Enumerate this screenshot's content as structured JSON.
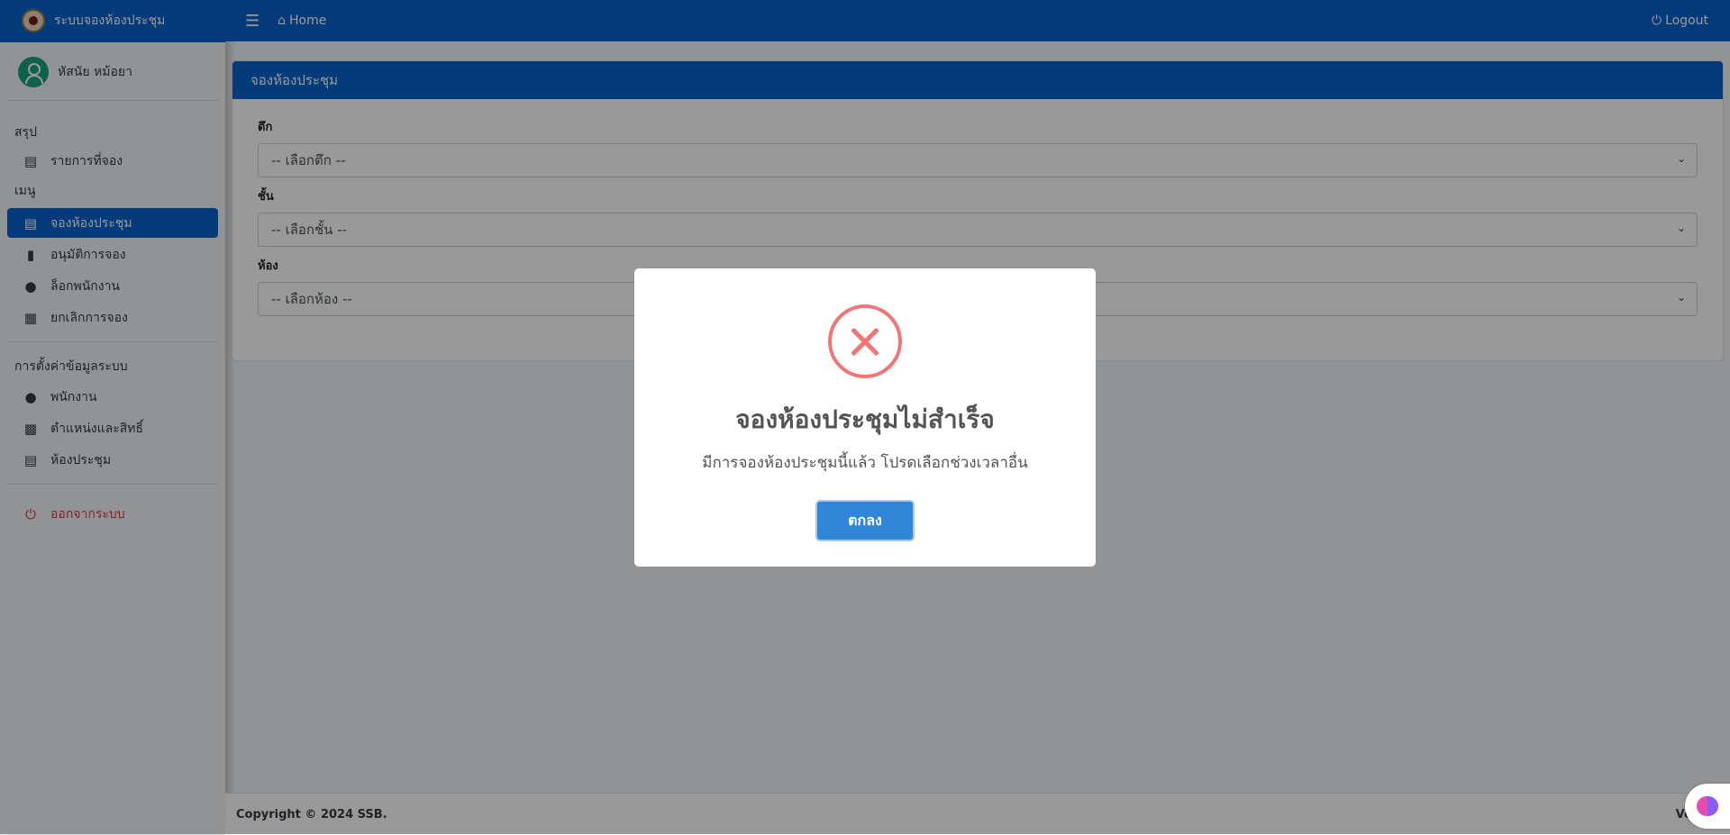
{
  "brand": {
    "title": "ระบบจองห้องประชุม"
  },
  "user": {
    "name": "หัสนัย หม้อยา"
  },
  "topbar": {
    "home": "Home",
    "logout": "Logout"
  },
  "sidebar": {
    "summary_header": "สรุป",
    "summary_items": [
      {
        "label": "รายการที่จอง",
        "icon": "book-icon"
      }
    ],
    "menu_header": "เมนู",
    "menu_items": [
      {
        "label": "จองห้องประชุม",
        "icon": "book-icon",
        "active": true
      },
      {
        "label": "อนุมัติการจอง",
        "icon": "stamp-icon"
      },
      {
        "label": "ล็อกพนักงาน",
        "icon": "user-lock-icon"
      },
      {
        "label": "ยกเลิกการจอง",
        "icon": "calendar-x-icon"
      }
    ],
    "settings_header": "การตั้งค่าข้อมูลระบบ",
    "settings_items": [
      {
        "label": "พนักงาน",
        "icon": "users-icon"
      },
      {
        "label": "ตำแหน่งและสิทธิ์",
        "icon": "bank-icon"
      },
      {
        "label": "ห้องประชุม",
        "icon": "clipboard-icon"
      }
    ],
    "logout": "ออกจากระบบ"
  },
  "card": {
    "title": "จองห้องประชุม",
    "building_label": "ตึก",
    "building_value": "-- เลือกตึก --",
    "floor_label": "ชั้น",
    "floor_value": "-- เลือกชั้น --",
    "room_label": "ห้อง",
    "room_value": "-- เลือกห้อง --"
  },
  "footer": {
    "copyright": "Copyright © 2024 SSB.",
    "version": "Vers"
  },
  "modal": {
    "title": "จองห้องประชุมไม่สำเร็จ",
    "text": "มีการจองห้องประชุมนี้แล้ว โปรดเลือกช่วงเวลาอื่น",
    "ok": "ตกลง",
    "icon": "error-x-icon",
    "color": "#f27474"
  },
  "colors": {
    "primary": "#0b63ce",
    "button": "#3085d6",
    "danger": "#dc3545"
  }
}
